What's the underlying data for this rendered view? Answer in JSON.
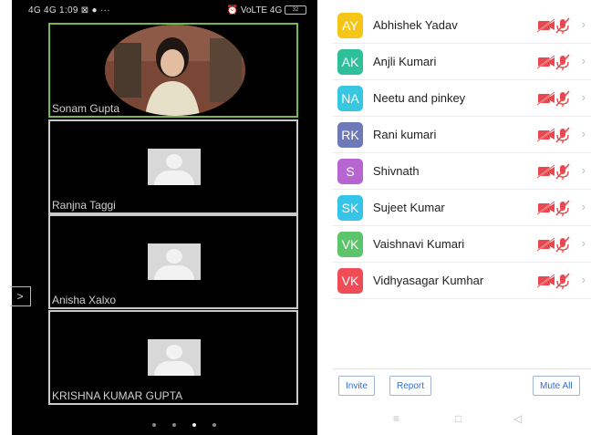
{
  "status_bar": {
    "left": "4G 4G 1:09 ⊠ ● ···",
    "right": "⏰ VoLTE 4G",
    "battery": "32"
  },
  "video_tiles": [
    {
      "name": "Sonam Gupta"
    },
    {
      "name": "Ranjna Taggi"
    },
    {
      "name": "Anisha Xalxo"
    },
    {
      "name": "KRISHNA KUMAR GUPTA"
    }
  ],
  "side_toggle": ">",
  "participants": [
    {
      "initials": "AY",
      "name": "Abhishek Yadav",
      "color": "#f5c518"
    },
    {
      "initials": "AK",
      "name": "Anjli Kumari",
      "color": "#2fbf9a"
    },
    {
      "initials": "NA",
      "name": "Neetu and pinkey",
      "color": "#37c7e0"
    },
    {
      "initials": "RK",
      "name": "Rani kumari",
      "color": "#6e79b8"
    },
    {
      "initials": "S",
      "name": "Shivnath",
      "color": "#b765d0"
    },
    {
      "initials": "SK",
      "name": "Sujeet Kumar",
      "color": "#36c4e8"
    },
    {
      "initials": "VK",
      "name": "Vaishnavi Kumari",
      "color": "#5cc46b"
    },
    {
      "initials": "VK",
      "name": "Vidhyasagar Kumhar",
      "color": "#f04c55"
    }
  ],
  "buttons": {
    "invite": "Invite",
    "report": "Report",
    "mute_all": "Mute All"
  },
  "navbar": {
    "menu": "≡",
    "home": "□",
    "back": "◁"
  }
}
